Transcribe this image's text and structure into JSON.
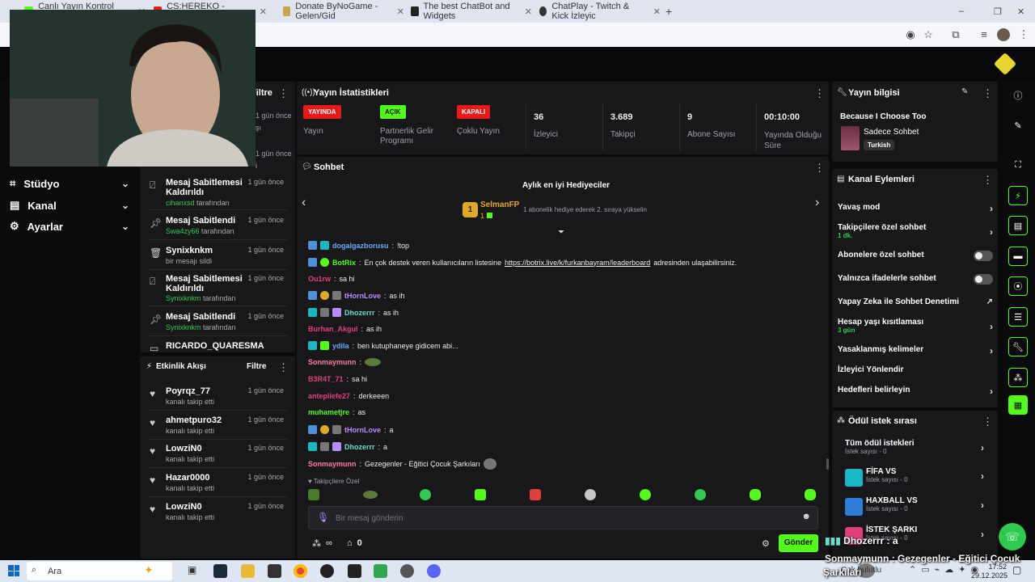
{
  "browser": {
    "tabs": [
      {
        "label": "Canlı Yayın Kontrol Paneli",
        "active": true
      },
      {
        "label": "CS:HEREKO - YOUTUBE",
        "active": false
      },
      {
        "label": "Donate ByNoGame - Gelen/Gid",
        "active": false
      },
      {
        "label": "The best ChatBot and Widgets",
        "active": false
      },
      {
        "label": "ChatPlay - Twitch & Kick İzleyic",
        "active": false
      }
    ],
    "new_tab": "+",
    "window_controls": [
      "–",
      "❐",
      "✕"
    ]
  },
  "sidebar": {
    "items": [
      {
        "label": "Stüdyo",
        "icon": "studio-icon"
      },
      {
        "label": "Kanal",
        "icon": "channel-icon"
      },
      {
        "label": "Ayarlar",
        "icon": "settings-icon"
      }
    ]
  },
  "mod_activity": {
    "title": "Filtre",
    "partial_top": [
      {
        "time": "1 gün önce",
        "sub": "şı"
      },
      {
        "time": "1 gün önce",
        "sub": "i"
      }
    ],
    "items": [
      {
        "title": "Mesaj Sabitlemesi Kaldırıldı",
        "user": "cihanxsd",
        "suffix": "tarafından",
        "time": "1 gün önce"
      },
      {
        "title": "Mesaj Sabitlendi",
        "user": "Swa4zy66",
        "suffix": "tarafından",
        "time": "1 gün önce"
      },
      {
        "title": "Synixknkm",
        "user": "",
        "suffix": "bir mesajı sildi",
        "time": "1 gün önce"
      },
      {
        "title": "Mesaj Sabitlemesi Kaldırıldı",
        "user": "Synixknkm",
        "suffix": "tarafından",
        "time": "1 gün önce"
      },
      {
        "title": "Mesaj Sabitlendi",
        "user": "Synixknkm",
        "suffix": "tarafından",
        "time": "1 gün önce"
      },
      {
        "title": "RICARDO_QUARESMA",
        "user": "",
        "suffix": "",
        "time": ""
      }
    ]
  },
  "activity_feed": {
    "title": "Etkinlik Akışı",
    "filter": "Filtre",
    "items": [
      {
        "name": "Poyrqz_77",
        "action": "kanalı takip etti",
        "time": "1 gün önce"
      },
      {
        "name": "ahmetpuro32",
        "action": "kanalı takip etti",
        "time": "1 gün önce"
      },
      {
        "name": "LowziN0",
        "action": "kanalı takip etti",
        "time": "1 gün önce"
      },
      {
        "name": "Hazar0000",
        "action": "kanalı takip etti",
        "time": "1 gün önce"
      },
      {
        "name": "LowziN0",
        "action": "kanalı takip etti",
        "time": "1 gün önce"
      }
    ]
  },
  "stats": {
    "title": "Yayın İstatistikleri",
    "items": [
      {
        "badge": "YAYINDA",
        "badge_color": "#e91916",
        "label": "Yayın"
      },
      {
        "badge": "AÇIK",
        "badge_color": "#53fc18",
        "label": "Partnerlik Gelir Programı"
      },
      {
        "badge": "KAPALI",
        "badge_color": "#e91916",
        "label": "Çoklu Yayın"
      },
      {
        "value": "36",
        "label": "İzleyici"
      },
      {
        "value": "3.689",
        "label": "Takipçi"
      },
      {
        "value": "9",
        "label": "Abone Sayısı"
      },
      {
        "value": "00:10:00",
        "label": "Yayında Olduğu Süre"
      }
    ]
  },
  "chat": {
    "title": "Sohbet",
    "gifters_title": "Aylık en iyi Hediyeciler",
    "top_gifter": "SelmanFP",
    "top_gifter_rank": "1",
    "top_gifter_count": "1",
    "gifter_note": "1 abonelik hediye ederek 2. sıraya yükselin",
    "messages": [
      {
        "user": "dogalgazborusu",
        "color": "#66aaff",
        "text": "!top"
      },
      {
        "user": "BotRix",
        "color": "#53fc18",
        "text": "En çok destek veren kullanıcıların listesine",
        "link": "https://botrix.live/k/furkanbayram/leaderboard",
        "after": "adresinden ulaşabilirsiniz."
      },
      {
        "user": "Ou1rw",
        "color": "#e0407a",
        "text": "sa hi"
      },
      {
        "user": "tHornLove",
        "color": "#b68cff",
        "text": "as ih"
      },
      {
        "user": "Dhozerrr",
        "color": "#66ddcc",
        "text": "as ih"
      },
      {
        "user": "Burhan_Akgul",
        "color": "#e0407a",
        "text": "as ih"
      },
      {
        "user": "ydila",
        "color": "#66aaff",
        "text": "ben kutuphaneye gidicem abi..."
      },
      {
        "user": "Sonmaymunn",
        "color": "#ff7aa8",
        "text": ""
      },
      {
        "user": "B3R4T_71",
        "color": "#e0407a",
        "text": "sa hi"
      },
      {
        "user": "antepliefe27",
        "color": "#e0407a",
        "text": "derkeeen"
      },
      {
        "user": "muhametjre",
        "color": "#53fc18",
        "text": "as"
      },
      {
        "user": "tHornLove",
        "color": "#b68cff",
        "text": "a"
      },
      {
        "user": "Dhozerrr",
        "color": "#66ddcc",
        "text": "a"
      },
      {
        "user": "Sonmaymunn",
        "color": "#ff7aa8",
        "text": "Gezegenler - Eğitici Çocuk Şarkıları"
      }
    ],
    "emote_label": "Takipçilere Özel",
    "input_placeholder": "Bir mesaj gönderin",
    "points": "∞",
    "gifts": "0",
    "send": "Gönder"
  },
  "stream_info": {
    "title": "Yayın bilgisi",
    "stream_title": "Because I Choose Too",
    "category": "Sadece Sohbet",
    "language": "Turkish"
  },
  "channel_actions": {
    "title": "Kanal Eylemleri",
    "items": [
      {
        "label": "Yavaş mod",
        "type": "chevron"
      },
      {
        "label": "Takipçilere özel sohbet",
        "sub": "1 dk.",
        "type": "chevron"
      },
      {
        "label": "Abonelere özel sohbet",
        "type": "toggle"
      },
      {
        "label": "Yalnızca ifadelerle sohbet",
        "type": "toggle"
      },
      {
        "label": "Yapay Zeka ile Sohbet Denetimi",
        "type": "external"
      },
      {
        "label": "Hesap yaşı kısıtlaması",
        "sub": "3 gün",
        "type": "chevron"
      },
      {
        "label": "Yasaklanmış kelimeler",
        "type": "chevron"
      },
      {
        "label": "İzleyici Yönlendir",
        "type": "none"
      },
      {
        "label": "Hedefleri belirleyin",
        "type": "chevron"
      }
    ]
  },
  "rewards": {
    "title": "Ödül istek sırası",
    "all": "Tüm ödül istekleri",
    "all_sub": "İstek sayısı - 0",
    "items": [
      {
        "label": "FİFA VS",
        "sub": "İstek sayısı - 0",
        "color": "#17b8c4"
      },
      {
        "label": "HAXBALL VS",
        "sub": "İstek sayısı - 0",
        "color": "#2b7fd9"
      },
      {
        "label": "İSTEK ŞARKI",
        "sub": "İstek sayısı - 0",
        "color": "#e0407a"
      }
    ]
  },
  "overlay": {
    "user1": "Dhozerrr",
    "text1": ": a",
    "user2": "Sonmaymunn",
    "text2": ": Gezegenler - Eğitici Çocuk",
    "text3": "Şarkıları",
    "weather": "Çok bulutlu"
  },
  "taskbar": {
    "search": "Ara",
    "time": "17:52",
    "date": "29.12.2025"
  },
  "colors": {
    "accent": "#53fc18",
    "panel": "#18181b",
    "live": "#e91916"
  }
}
